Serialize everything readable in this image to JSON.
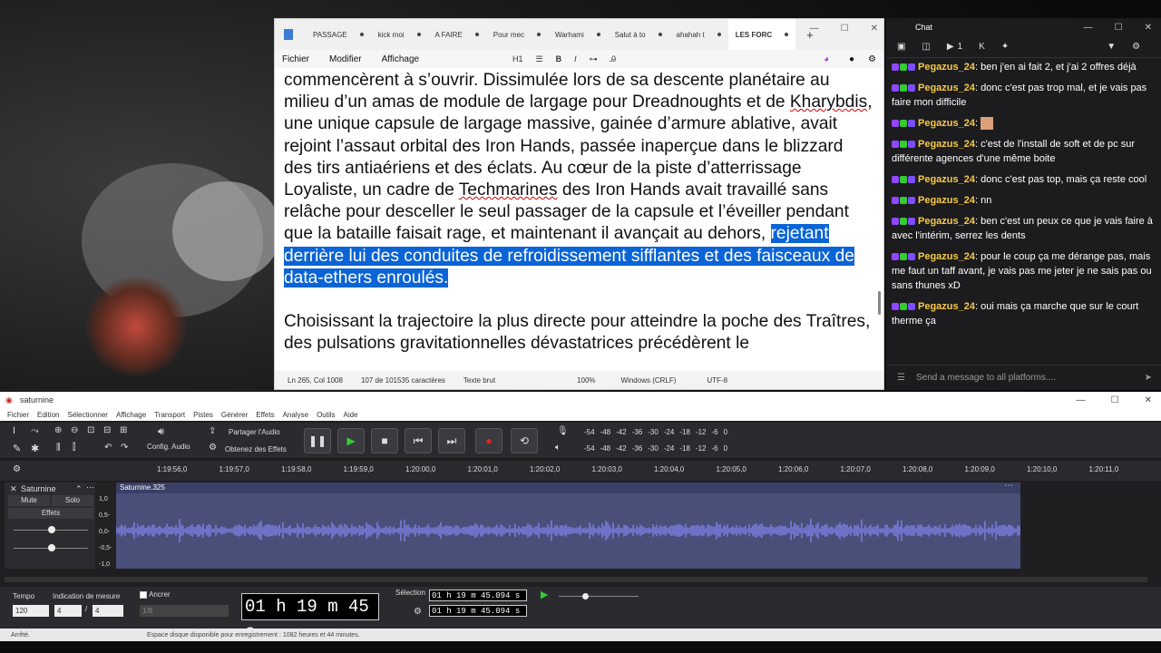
{
  "notepad": {
    "tabs": [
      "PASSAGE",
      "kick moi",
      "A FAIRE",
      "Pour mec",
      "Warhami",
      "Salut à to",
      "ahahah t",
      "LES FORC"
    ],
    "menu": [
      "Fichier",
      "Modifier",
      "Affichage"
    ],
    "toolbar_heading": "H1",
    "para1_a": "commencèrent à s’ouvrir. Dissimulée lors de sa descente planétaire au milieu d’un amas de module de largage pour Dreadnoughts et de ",
    "para1_b": "Kharybdis",
    "para1_c": ", une unique capsule de largage massive, gainée d’armure ablative, avait rejoint l’assaut orbital des Iron Hands, passée inaperçue dans le blizzard des tirs antiaériens et des éclats. Au cœur de la piste d’atterrissage Loyaliste, un cadre de ",
    "para1_d": "Techmarines",
    "para1_e": " des Iron Hands avait travaillé sans relâche pour desceller le seul passager de la capsule et l’éveiller pendant que la bataille faisait rage, et maintenant il avançait au dehors, ",
    "para1_sel": "rejetant derrière lui des conduites de refroidissement sifflantes et des faisceaux de data-ethers enroulés.",
    "para2": "Choisissant la trajectoire la plus directe pour atteindre la poche des Traîtres, des pulsations gravitationnelles dévastatrices précédèrent le",
    "status": [
      "Ln 265, Col 1008",
      "107 de 101535 caractères",
      "Texte brut",
      "100%",
      "Windows (CRLF)",
      "UTF-8"
    ]
  },
  "chat": {
    "title": "Chat",
    "count": "1",
    "messages": [
      {
        "user": "Pegazus_24",
        "text": ": ben j'en ai fait 2, et j'ai 2 offres déjà"
      },
      {
        "user": "Pegazus_24",
        "text": ": donc c'est pas trop mal, et je vais pas faire mon difficile"
      },
      {
        "user": "Pegazus_24",
        "text": ": "
      },
      {
        "user": "Pegazus_24",
        "text": ": c'est de l'install de soft et de pc sur différente agences d'une même boite"
      },
      {
        "user": "Pegazus_24",
        "text": ": donc c'est pas top, mais ça reste cool"
      },
      {
        "user": "Pegazus_24",
        "text": ": nn"
      },
      {
        "user": "Pegazus_24",
        "text": ": ben c'est un peux ce que je vais faire à avec l'intérim, serrez les dents"
      },
      {
        "user": "Pegazus_24",
        "text": ": pour le coup ça me dérange pas, mais me faut un taff avant, je vais pas me jeter je ne sais pas ou sans thunes xD"
      },
      {
        "user": "Pegazus_24",
        "text": ": oui mais ça marche que sur le court therme ça"
      }
    ],
    "input_placeholder": "Send a message to all platforms...."
  },
  "audacity": {
    "title": "saturnine",
    "menu": [
      "Fichier",
      "Edition",
      "Sélectionner",
      "Affichage",
      "Transport",
      "Pistes",
      "Générer",
      "Effets",
      "Analyse",
      "Outils",
      "Aide"
    ],
    "config_audio": "Config. Audio",
    "share": "Partager l'Audio",
    "get_effects": "Obtenez des Effets",
    "meter_labels": [
      "-54",
      "-48",
      "-42",
      "-36",
      "-30",
      "-24",
      "-18",
      "-12",
      "-6",
      "0"
    ],
    "ruler": [
      "1:19:56,0",
      "1:19:57,0",
      "1:19:58,0",
      "1:19:59,0",
      "1:20:00,0",
      "1:20:01,0",
      "1:20:02,0",
      "1:20:03,0",
      "1:20:04,0",
      "1:20:05,0",
      "1:20:06,0",
      "1:20:07,0",
      "1:20:08,0",
      "1:20:09,0",
      "1:20:10,0",
      "1:20:11,0"
    ],
    "track_name": "Saturnine",
    "mute": "Mute",
    "solo": "Solo",
    "effects": "Effets",
    "clip_name": "Saturnine.325",
    "scale": [
      "1,0",
      "0,5-",
      "0,0-",
      "-0,5-",
      "-1,0"
    ],
    "tempo_label": "Tempo",
    "tempo": "120",
    "measure_label": "Indication de mesure",
    "measure_a": "4",
    "measure_b": "4",
    "snap_label": "Ancrer",
    "snap_value": "1/8",
    "time": "01 h 19 m 45 s",
    "selection_label": "Sélection",
    "sel_start": "01 h 19 m 45.094 s",
    "sel_end": "01 h 19 m 45.094 s",
    "status_left": "Arrêté.",
    "status_right": "Espace disque disponible pour enregistrement : 1082 heures et 44 minutes."
  }
}
